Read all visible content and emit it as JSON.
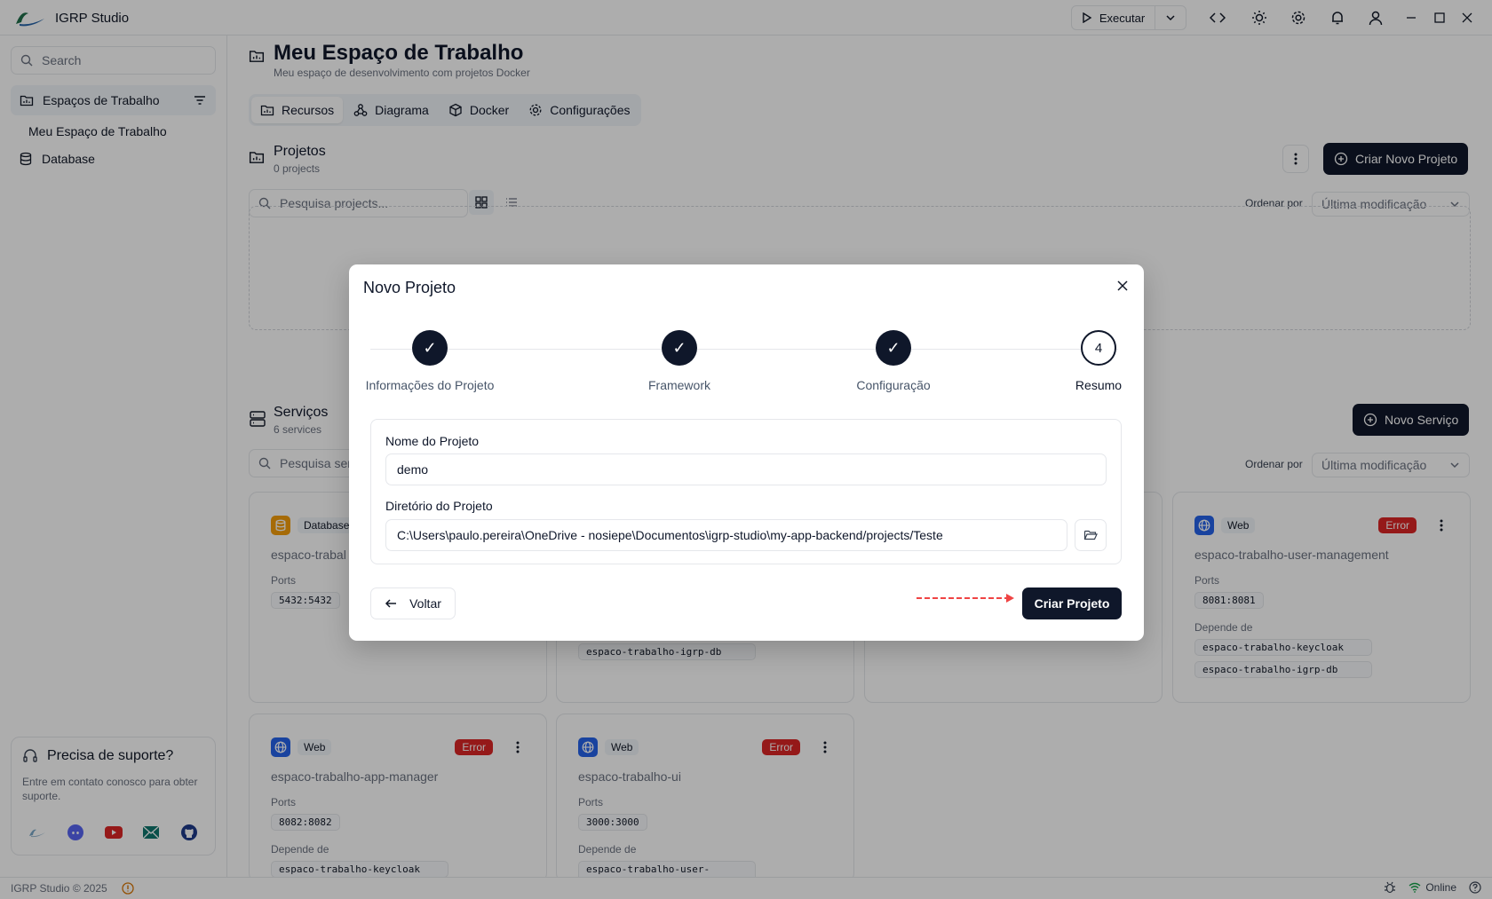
{
  "app": {
    "title": "IGRP Studio"
  },
  "titlebar": {
    "run_label": "Executar"
  },
  "sidebar": {
    "search_placeholder": "Search",
    "workspaces_label": "Espaços de Trabalho",
    "workspace_item": "Meu Espaço de Trabalho",
    "database_label": "Database",
    "support": {
      "title": "Precisa de suporte?",
      "description": "Entre em contato conosco para obter suporte."
    }
  },
  "workspace": {
    "title": "Meu Espaço de Trabalho",
    "subtitle": "Meu espaço de desenvolvimento com projetos Docker",
    "tabs": [
      {
        "label": "Recursos",
        "icon": "folder-chart-icon",
        "active": true
      },
      {
        "label": "Diagrama",
        "icon": "diagram-icon"
      },
      {
        "label": "Docker",
        "icon": "box-icon"
      },
      {
        "label": "Configurações",
        "icon": "gear-icon"
      }
    ]
  },
  "projects": {
    "title": "Projetos",
    "count": "0 projects",
    "create_label": "Criar Novo Projeto",
    "search_placeholder": "Pesquisa projects...",
    "sort_label": "Ordenar por",
    "sort_value": "Última modificação"
  },
  "services": {
    "title": "Serviços",
    "count": "6 services",
    "new_label": "Novo Serviço",
    "search_placeholder": "Pesquisa serv",
    "sort_label": "Ordenar por",
    "sort_value": "Última modificação",
    "cards": [
      {
        "type": "Database",
        "name": "espaco-trabal",
        "ports_label": "Ports",
        "ports": "5432:5432"
      },
      {
        "type": "",
        "name": "",
        "deps": [
          "espaco-trabalho-igrp-db"
        ]
      },
      {
        "type": "Web",
        "status": "Error",
        "name": "espaco-trabalho-user-management",
        "ports_label": "Ports",
        "ports": "8081:8081",
        "deps_label": "Depende de",
        "deps": [
          "espaco-trabalho-keycloak",
          "espaco-trabalho-igrp-db"
        ]
      },
      {
        "type": "Web",
        "status": "Error",
        "name": "espaco-trabalho-app-manager",
        "ports_label": "Ports",
        "ports": "8082:8082",
        "deps_label": "Depende de",
        "deps": [
          "espaco-trabalho-keycloak"
        ]
      },
      {
        "type": "Web",
        "status": "Error",
        "name": "espaco-trabalho-ui",
        "ports_label": "Ports",
        "ports": "3000:3000",
        "deps_label": "Depende de",
        "deps": [
          "espaco-trabalho-user-manag..."
        ]
      }
    ]
  },
  "modal": {
    "title": "Novo Projeto",
    "steps": [
      {
        "label": "Informações do Projeto",
        "mark": "✓"
      },
      {
        "label": "Framework",
        "mark": "✓"
      },
      {
        "label": "Configuração",
        "mark": "✓"
      },
      {
        "label": "Resumo",
        "mark": "4"
      }
    ],
    "name_label": "Nome do Projeto",
    "name_value": "demo",
    "dir_label": "Diretório do Projeto",
    "dir_value": "C:\\Users\\paulo.pereira\\OneDrive - nosiepe\\Documentos\\igrp-studio\\my-app-backend/projects/Teste",
    "back_label": "Voltar",
    "create_label": "Criar Projeto"
  },
  "statusbar": {
    "copyright": "IGRP Studio © 2025",
    "online": "Online"
  },
  "colors": {
    "primary": "#0f172a",
    "error": "#dc2626",
    "accent_db": "#f59e0b",
    "accent_web": "#2563eb",
    "online": "#16a34a"
  }
}
